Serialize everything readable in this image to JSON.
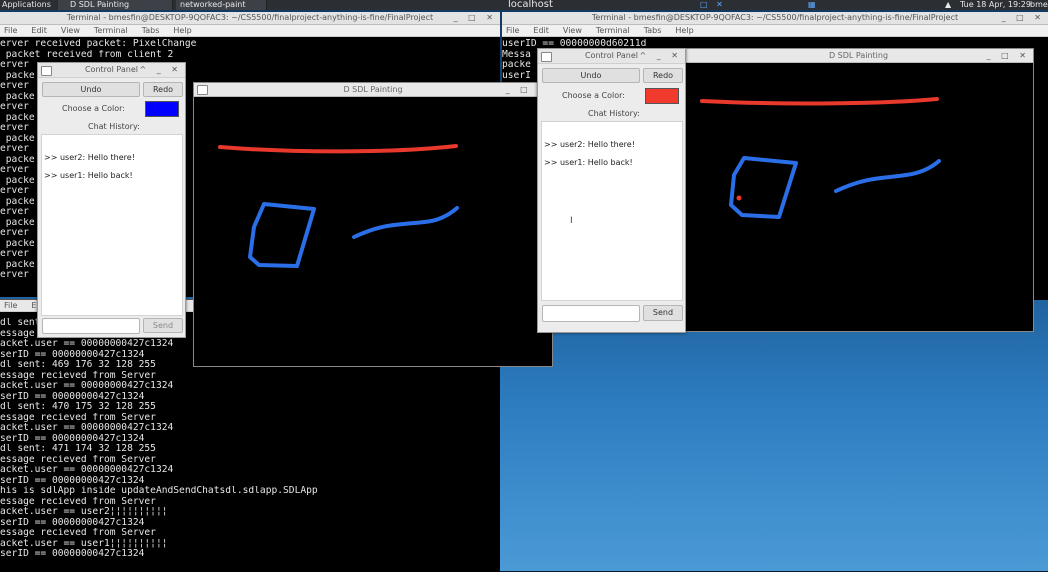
{
  "top_panel": {
    "applications": "Applications",
    "tasks": [
      "D SDL Painting",
      "networked-paint"
    ],
    "center_title": "localhost",
    "clock": "Tue 18 Apr, 19:29",
    "user": "bmes"
  },
  "term_left": {
    "title": "Terminal - bmesfin@DESKTOP-9QOFAC3: ~/CS5500/finalproject-anything-is-fine/FinalProject",
    "menu": [
      "File",
      "Edit",
      "View",
      "Terminal",
      "Tabs",
      "Help"
    ],
    "lines": [
      "erver received packet: PixelChange",
      " packet received from client 2",
      "erver",
      " packe",
      "erver",
      " packe",
      "erver",
      " packe",
      "erver",
      " packe",
      "erver",
      " packe",
      "erver",
      " packe",
      "erver",
      " packe",
      "erver",
      " packe",
      "erver",
      " packe",
      "erver",
      " packe",
      "erver"
    ]
  },
  "term_left_bottom": {
    "menu": [
      "File",
      "Edit"
    ],
    "lines": [
      "dl sent",
      "essage recieved from Server",
      "acket.user == 00000000427c1324",
      "serID == 00000000427c1324",
      "dl sent: 469 176 32 128 255",
      "essage recieved from Server",
      "acket.user == 00000000427c1324",
      "serID == 00000000427c1324",
      "dl sent: 470 175 32 128 255",
      "essage recieved from Server",
      "acket.user == 00000000427c1324",
      "serID == 00000000427c1324",
      "dl sent: 471 174 32 128 255",
      "essage recieved from Server",
      "acket.user == 00000000427c1324",
      "serID == 00000000427c1324",
      "his is sdlApp inside updateAndSendChatsdl.sdlapp.SDLApp",
      "essage recieved from Server",
      "acket.user == user2¦¦¦¦¦¦¦¦¦¦",
      "serID == 00000000427c1324",
      "essage recieved from Server",
      "acket.user == user1¦¦¦¦¦¦¦¦¦¦",
      "serID == 00000000427c1324"
    ]
  },
  "term_right": {
    "title": "Terminal - bmesfin@DESKTOP-9QOFAC3: ~/CS5500/finalproject-anything-is-fine/FinalProject",
    "menu": [
      "File",
      "Edit",
      "View",
      "Terminal",
      "Tabs",
      "Help"
    ],
    "lines": [
      "userID == 00000000d60211d",
      "Messa",
      "packe",
      "userI"
    ]
  },
  "control_panel_left": {
    "title": "Control Panel",
    "undo": "Undo",
    "redo": "Redo",
    "choose_color": "Choose a Color:",
    "color": "#0000ff",
    "chat_history": "Chat History:",
    "messages": [
      ">> user2: Hello there!",
      ">> user1: Hello back!"
    ],
    "input_value": "",
    "send": "Send"
  },
  "control_panel_right": {
    "title": "Control Panel",
    "undo": "Undo",
    "redo": "Redo",
    "choose_color": "Choose a Color:",
    "color": "#f03a2e",
    "chat_history": "Chat History:",
    "messages": [
      ">> user2: Hello there!",
      ">> user1: Hello back!"
    ],
    "input_value": "",
    "send": "Send"
  },
  "paint_left": {
    "title": "D SDL Painting"
  },
  "paint_right": {
    "title": "D SDL Painting"
  },
  "colors": {
    "stroke_red": "#e8392c",
    "stroke_blue": "#2b6fe8",
    "dot_red": "#e8392c"
  }
}
